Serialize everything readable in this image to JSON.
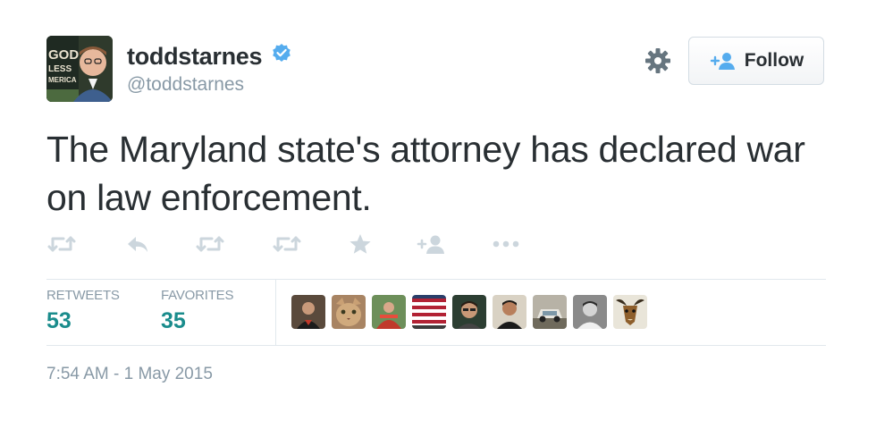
{
  "user": {
    "display_name": "toddstarnes",
    "handle": "@toddstarnes",
    "avatar_book_text": "GOD BLESS AMERICA",
    "verified": true
  },
  "follow_button": {
    "label": "Follow"
  },
  "tweet": {
    "text": "The Maryland state's attorney has declared war on law enforcement.",
    "timestamp": "7:54 AM - 1 May 2015"
  },
  "stats": {
    "retweets_label": "RETWEETS",
    "retweets_count": "53",
    "favorites_label": "FAVORITES",
    "favorites_count": "35"
  },
  "actions": [
    "retweet-icon",
    "reply-icon",
    "retweet-icon",
    "retweet-icon",
    "favorite-star-icon",
    "add-user-icon",
    "more-dots-icon"
  ],
  "colors": {
    "text": "#292f33",
    "muted": "#8899a6",
    "action_icon": "#ccd6dd",
    "stat_value": "#1a8c8c",
    "verified": "#55acee",
    "follow_icon": "#55acee"
  }
}
